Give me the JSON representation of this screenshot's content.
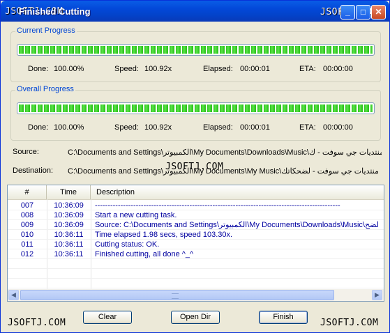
{
  "window": {
    "title": "Finished Cutting",
    "title_prefix_overlap": "JSOFTJ.COM",
    "minimize_glyph": "_",
    "maximize_glyph": "□",
    "close_glyph": "✕"
  },
  "watermarks": {
    "top_right": "JSOFTJ.COM",
    "middle": "JSOFTJ.COM",
    "bottom_left": "JSOFTJ.COM",
    "bottom_right": "JSOFTJ.COM"
  },
  "current_progress": {
    "label": "Current Progress",
    "percent": 100,
    "done_label": "Done:",
    "done_value": "100.00%",
    "speed_label": "Speed:",
    "speed_value": "100.92x",
    "elapsed_label": "Elapsed:",
    "elapsed_value": "00:00:01",
    "eta_label": "ETA:",
    "eta_value": "00:00:00"
  },
  "overall_progress": {
    "label": "Overall Progress",
    "percent": 100,
    "done_label": "Done:",
    "done_value": "100.00%",
    "speed_label": "Speed:",
    "speed_value": "100.92x",
    "elapsed_label": "Elapsed:",
    "elapsed_value": "00:00:01",
    "eta_label": "ETA:",
    "eta_value": "00:00:00"
  },
  "paths": {
    "source_label": "Source:",
    "source_value": "C:\\Documents and Settings\\الكمبيوتر\\My Documents\\Downloads\\Music\\منتديات جي سوفت - ك",
    "destination_label": "Destination:",
    "destination_value": "C:\\Documents and Settings\\الكمبيوتر\\My Documents\\My Music\\منتديات جي سوفت - لضحكاتك"
  },
  "log": {
    "columns": [
      "#",
      "Time",
      "Description"
    ],
    "rows": [
      {
        "num": "007",
        "time": "10:36:09",
        "desc": "------------------------------------------------------------------------------------------------"
      },
      {
        "num": "008",
        "time": "10:36:09",
        "desc": "Start a new cutting task."
      },
      {
        "num": "009",
        "time": "10:36:09",
        "desc": "Source:  C:\\Documents and Settings\\الكمبيوتر\\My Documents\\Downloads\\Music\\ي لضح"
      },
      {
        "num": "010",
        "time": "10:36:11",
        "desc": "Time elapsed 1.98 secs, speed 103.30x."
      },
      {
        "num": "011",
        "time": "10:36:11",
        "desc": "Cutting status: OK."
      },
      {
        "num": "012",
        "time": "10:36:11",
        "desc": "Finished cutting, all done ^_^"
      }
    ],
    "scroll_left": "◀",
    "scroll_right": "▶"
  },
  "buttons": {
    "clear": "Clear",
    "open_dir": "Open Dir",
    "finish": "Finish"
  },
  "colors": {
    "titlebar": "#0348d8",
    "group_label": "#0046d5",
    "progress_fill": "#2dc41c",
    "log_text": "#0000a0"
  }
}
